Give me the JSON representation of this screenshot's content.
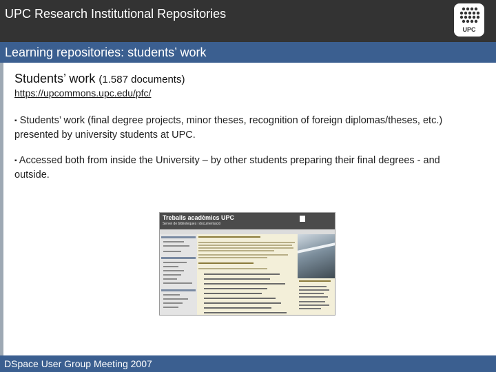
{
  "header": {
    "title": "UPC Research Institutional Repositories",
    "logo_text": "UPC"
  },
  "section": {
    "title": "Learning repositories: students’ work"
  },
  "content": {
    "heading_main": "Students’ work",
    "heading_count": "(1.587 documents)",
    "url": "https://upcommons.upc.edu/pfc/",
    "bullet": "▪",
    "paragraph1": "Students’ work (final degree projects, minor theses, recognition of foreign diplomas/theses, etc.) presented by university students at UPC.",
    "paragraph2": "Accessed both from inside the University – by other students preparing their final degrees - and outside."
  },
  "embedded_screenshot": {
    "title": "Treballs acadèmics UPC",
    "subtitle": "Servei de biblioteques i documentació"
  },
  "footer": {
    "text": "DSpace User Group Meeting 2007"
  },
  "colors": {
    "top_bar": "#333333",
    "section_bar": "#3b5f90",
    "footer_bar": "#3b5f90"
  }
}
